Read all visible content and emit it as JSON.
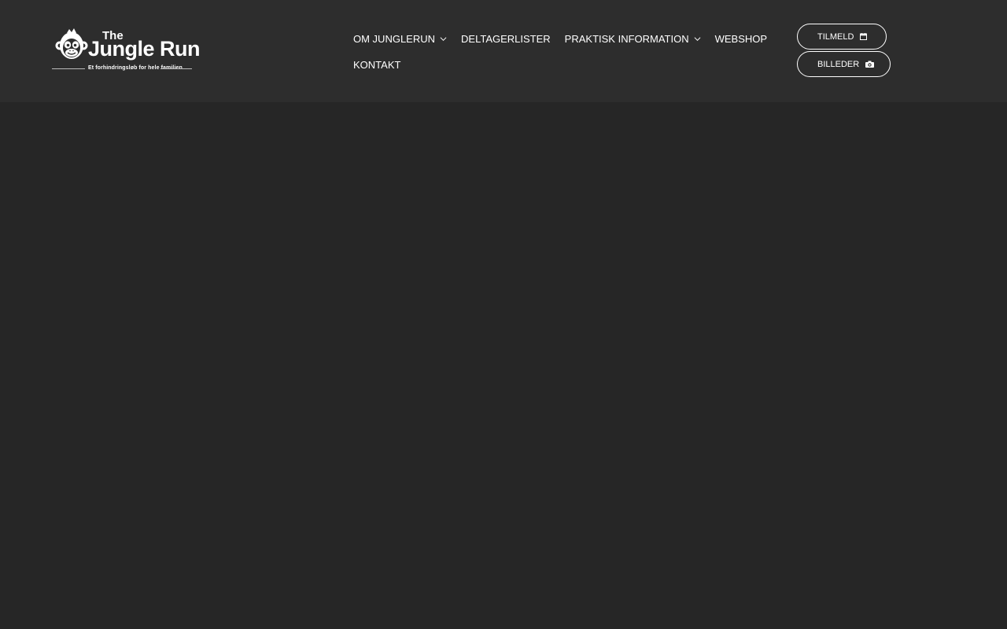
{
  "logo": {
    "the": "The",
    "name": "Jungle Run",
    "tagline": "Et forhindringsløb for hele familien",
    "icon": "monkey-icon"
  },
  "nav": {
    "items": [
      {
        "label": "OM JUNGLERUN",
        "dropdown": true
      },
      {
        "label": "DELTAGERLISTER",
        "dropdown": false
      },
      {
        "label": "PRAKTISK INFORMATION",
        "dropdown": true
      },
      {
        "label": "WEBSHOP",
        "dropdown": false
      },
      {
        "label": "KONTAKT",
        "dropdown": false
      }
    ]
  },
  "buttons": {
    "tilmeld": {
      "label": "TILMELD",
      "icon": "calendar-icon"
    },
    "billeder": {
      "label": "BILLEDER",
      "icon": "camera-icon"
    }
  },
  "colors": {
    "page_background": "#262626",
    "header_background": "#2d2d2d",
    "text": "#ffffff"
  }
}
